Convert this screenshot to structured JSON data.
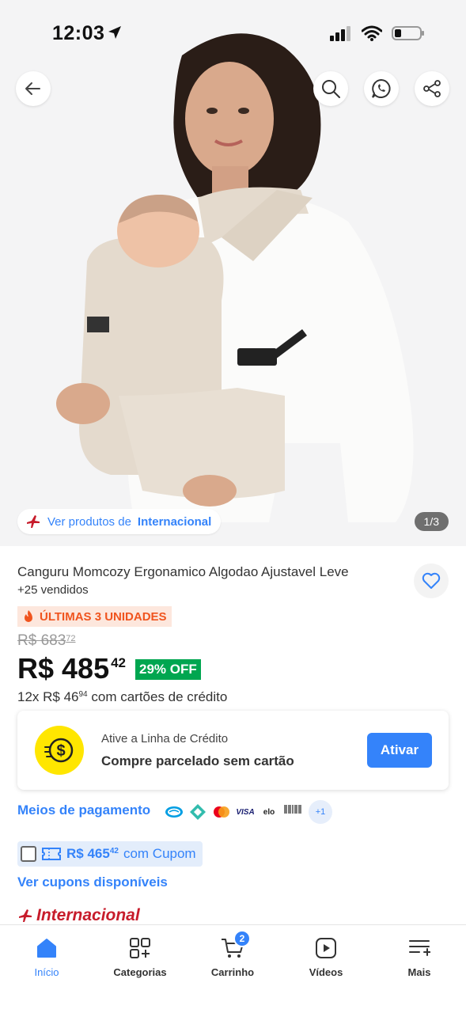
{
  "status_bar": {
    "time": "12:03"
  },
  "hero": {
    "image_alt": "mother-with-baby-carrier-photo",
    "intl_chip": {
      "prefix": "Ver produtos de",
      "bold": "Internacional"
    },
    "page_counter": "1/3"
  },
  "product": {
    "title": "Canguru Momcozy Ergonamico Algodao Ajustavel Leve",
    "sold": "+25 vendidos",
    "stock_badge": "ÚLTIMAS 3 UNIDADES",
    "old_price": {
      "main": "R$ 683",
      "cents": "72"
    },
    "price": {
      "main": "R$ 485",
      "cents": "42"
    },
    "discount": "29% OFF",
    "installments": {
      "prefix": "12x R$ 46",
      "cents": "94",
      "suffix": "com cartões de crédito"
    }
  },
  "credit": {
    "title": "Ative a Linha de Crédito",
    "subtitle": "Compre parcelado sem cartão",
    "button": "Ativar"
  },
  "payment": {
    "label": "Meios de pagamento",
    "icons": [
      "mercado-pago-icon",
      "pix-icon",
      "mastercard-icon",
      "visa-icon",
      "elo-icon",
      "boleto-icon"
    ],
    "visa_text": "VISA",
    "elo_text": "elo",
    "boleto_text": "Boleto",
    "more": "+1"
  },
  "coupon": {
    "price_main": "R$ 465",
    "price_cents": "42",
    "text": "com Cupom",
    "link": "Ver cupons disponíveis"
  },
  "brand": {
    "label": "Internacional"
  },
  "nav": {
    "items": [
      {
        "label": "Início",
        "icon": "home-icon",
        "active": true
      },
      {
        "label": "Categorias",
        "icon": "categories-icon"
      },
      {
        "label": "Carrinho",
        "icon": "cart-icon",
        "badge": "2"
      },
      {
        "label": "Vídeos",
        "icon": "video-icon"
      },
      {
        "label": "Mais",
        "icon": "more-icon"
      }
    ]
  },
  "colors": {
    "accent": "#3483fa",
    "discount_green": "#00a650",
    "stock_orange": "#f0541e",
    "credit_yellow": "#ffe600",
    "brand_red": "#c71c2b"
  }
}
